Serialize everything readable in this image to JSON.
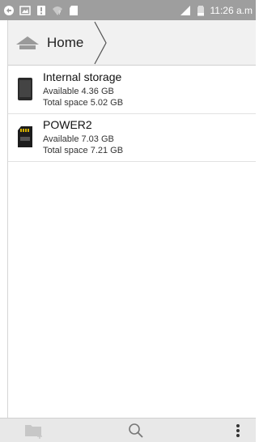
{
  "status_bar": {
    "time": "11:26 a.m",
    "left_icons": [
      "sync-icon",
      "image-icon",
      "alert-icon",
      "wifi-icon",
      "sd-card-icon"
    ],
    "right_icons": [
      "signal-icon",
      "battery-icon"
    ]
  },
  "breadcrumb": {
    "home_label": "Home",
    "home_icon": "home-icon"
  },
  "storage_items": [
    {
      "name": "Internal storage",
      "available": "Available 4.36 GB",
      "total": "Total space 5.02 GB",
      "icon": "phone-storage-icon"
    },
    {
      "name": "POWER2",
      "available": "Available 7.03 GB",
      "total": "Total space 7.21 GB",
      "icon": "sd-card-icon"
    }
  ],
  "bottom_bar": {
    "icons": [
      "new-folder-icon",
      "search-icon",
      "more-options-icon"
    ]
  },
  "colors": {
    "status_bar": "#9e9e9e",
    "breadcrumb_bar": "#f1f1f1",
    "bottom_bar": "#e8e8e8"
  }
}
